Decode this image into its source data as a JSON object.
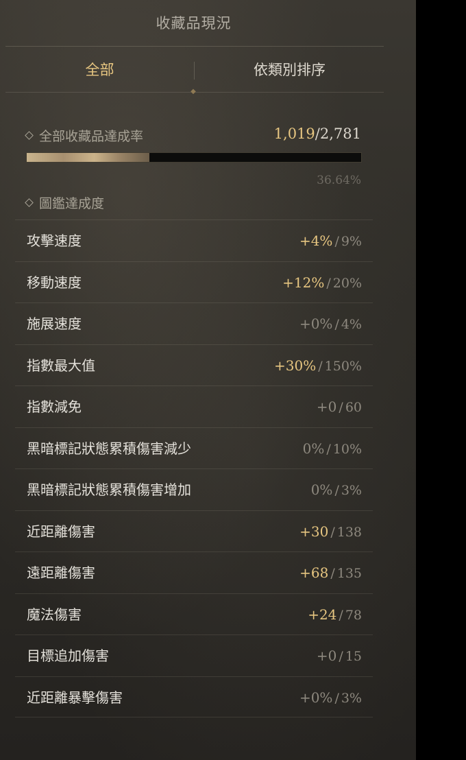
{
  "panel": {
    "title": "收藏品現況",
    "tabs": {
      "all": "全部",
      "sort": "依類別排序"
    },
    "completion": {
      "label": "全部收藏品達成率",
      "current": "1,019",
      "total": "2,781",
      "percent_text": "36.64%",
      "progress_fraction": 0.3664
    },
    "codex_label": "圖鑑達成度",
    "stats": [
      {
        "name": "攻擊速度",
        "current": "+4%",
        "max": "9%",
        "highlight": true
      },
      {
        "name": "移動速度",
        "current": "+12%",
        "max": "20%",
        "highlight": true
      },
      {
        "name": "施展速度",
        "current": "+0%",
        "max": "4%",
        "highlight": false
      },
      {
        "name": "指數最大值",
        "current": "+30%",
        "max": "150%",
        "highlight": true
      },
      {
        "name": "指數減免",
        "current": "+0",
        "max": "60",
        "highlight": false
      },
      {
        "name": "黑暗標記狀態累積傷害減少",
        "current": "0%",
        "max": "10%",
        "highlight": false
      },
      {
        "name": "黑暗標記狀態累積傷害增加",
        "current": "0%",
        "max": "3%",
        "highlight": false
      },
      {
        "name": "近距離傷害",
        "current": "+30",
        "max": "138",
        "highlight": true
      },
      {
        "name": "遠距離傷害",
        "current": "+68",
        "max": "135",
        "highlight": true
      },
      {
        "name": "魔法傷害",
        "current": "+24",
        "max": "78",
        "highlight": true
      },
      {
        "name": "目標追加傷害",
        "current": "+0",
        "max": "15",
        "highlight": false
      },
      {
        "name": "近距離暴擊傷害",
        "current": "+0%",
        "max": "3%",
        "highlight": false
      }
    ],
    "colors": {
      "accent_gold": "#e7c681",
      "text_light": "#e4e1da",
      "text_dim": "#8e897f"
    }
  }
}
